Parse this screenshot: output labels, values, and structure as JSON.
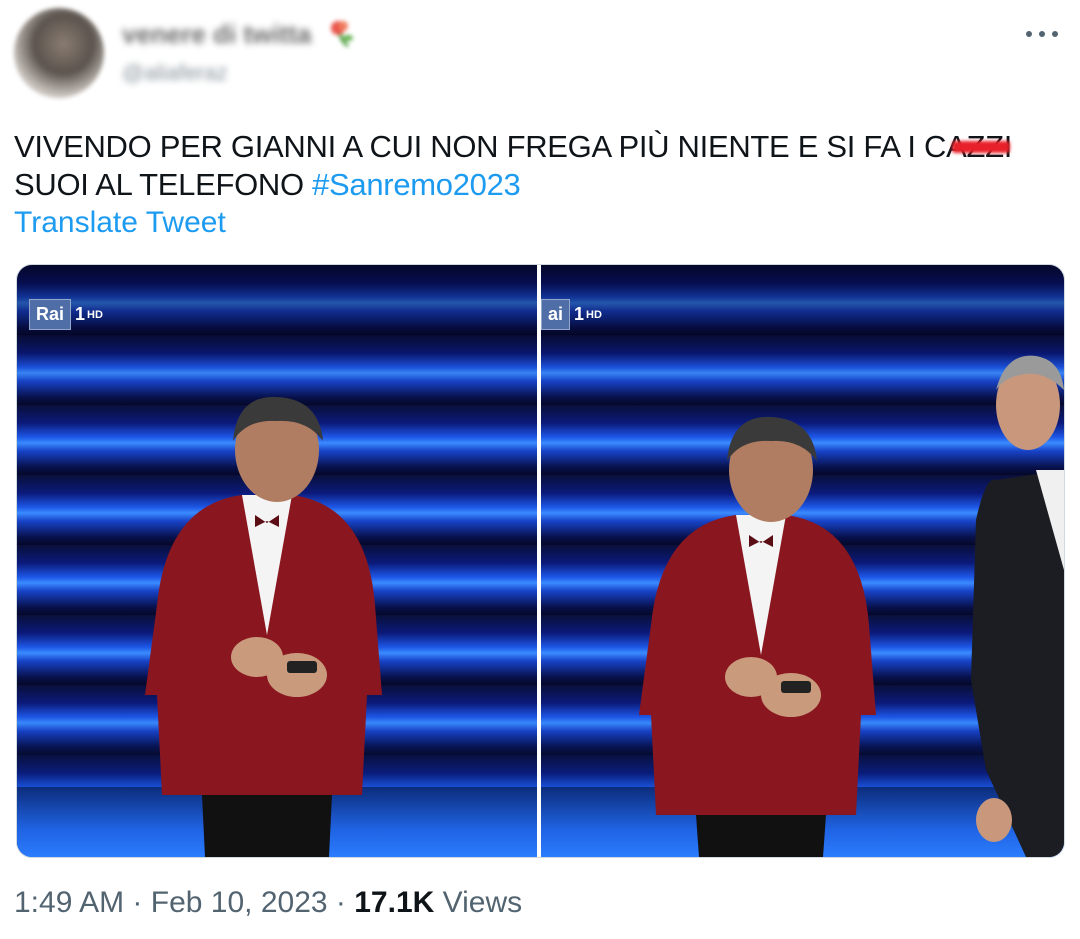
{
  "author": {
    "display_name": "venere di twitta",
    "handle": "@aliaferaz"
  },
  "tweet": {
    "text_before_censor": "VIVENDO PER GIANNI A CUI NON FREGA PIÙ NIENTE E SI FA I C",
    "censored_fragment": "AZZI",
    "text_after_censor": " SUOI AL TELEFONO ",
    "hashtag": "#Sanremo2023",
    "translate_label": "Translate Tweet"
  },
  "media": {
    "left_logo": {
      "rai": "Rai",
      "channel": "1",
      "hd": "HD"
    },
    "right_logo": {
      "rai": "ai",
      "channel": "1",
      "hd": "HD"
    }
  },
  "meta": {
    "time": "1:49 AM",
    "separator": " · ",
    "date": "Feb 10, 2023",
    "views_count": "17.1K",
    "views_label": " Views"
  },
  "icons": {
    "more": "more-horizontal-icon",
    "flower": "flower-emoji-icon"
  },
  "colors": {
    "link": "#1d9bf0",
    "secondary": "#536471",
    "text": "#0f1419"
  }
}
